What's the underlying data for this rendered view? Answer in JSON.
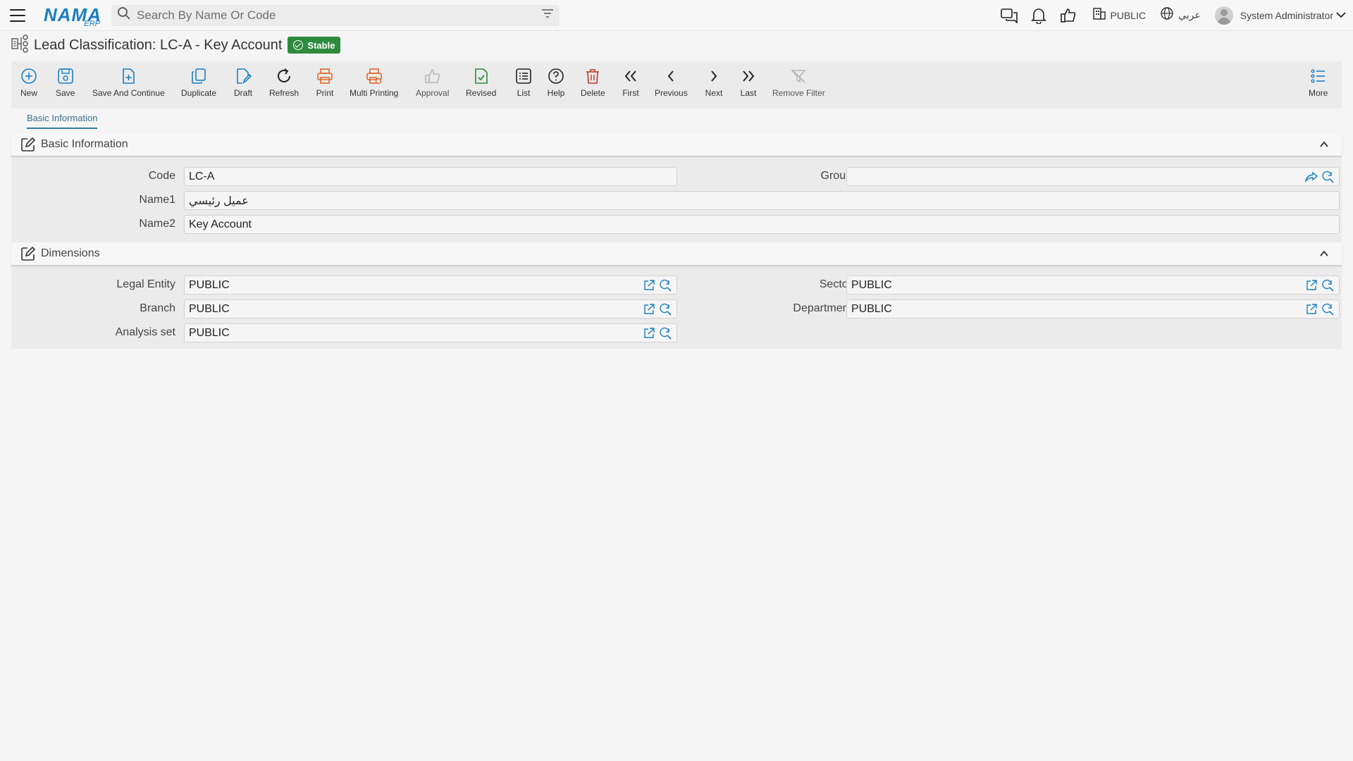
{
  "header": {
    "logo_main": "NAMA",
    "logo_sub": "ERP",
    "search_placeholder": "Search By Name Or Code",
    "legal_entity": "PUBLIC",
    "language": "عربي",
    "user_name": "System Administrator"
  },
  "page": {
    "title": "Lead Classification: LC-A - Key Account",
    "status": "Stable"
  },
  "toolbar": {
    "new": "New",
    "save": "Save",
    "save_continue": "Save And Continue",
    "duplicate": "Duplicate",
    "draft": "Draft",
    "refresh": "Refresh",
    "print": "Print",
    "multi_printing": "Multi Printing",
    "approval": "Approval",
    "revised": "Revised",
    "list": "List",
    "help": "Help",
    "delete": "Delete",
    "first": "First",
    "previous": "Previous",
    "next": "Next",
    "last": "Last",
    "remove_filter": "Remove Filter",
    "more": "More"
  },
  "tabs": {
    "basic_information": "Basic Information"
  },
  "basic_section": {
    "title": "Basic Information",
    "code_label": "Code",
    "code_value": "LC-A",
    "group_label": "Group",
    "group_value": "",
    "name1_label": "Name1",
    "name1_value": "عميل رئيسي",
    "name2_label": "Name2",
    "name2_value": "Key Account"
  },
  "dimensions_section": {
    "title": "Dimensions",
    "legal_entity_label": "Legal Entity",
    "legal_entity_value": "PUBLIC",
    "sector_label": "Sector",
    "sector_value": "PUBLIC",
    "branch_label": "Branch",
    "branch_value": "PUBLIC",
    "department_label": "Department",
    "department_value": "PUBLIC",
    "analysis_set_label": "Analysis set",
    "analysis_set_value": "PUBLIC"
  },
  "colors": {
    "accent_blue": "#1a7fc1",
    "stable_green": "#2e8b3e",
    "print_orange": "#e0672b",
    "delete_red": "#c0392b",
    "revised_green": "#2e8b3e"
  }
}
